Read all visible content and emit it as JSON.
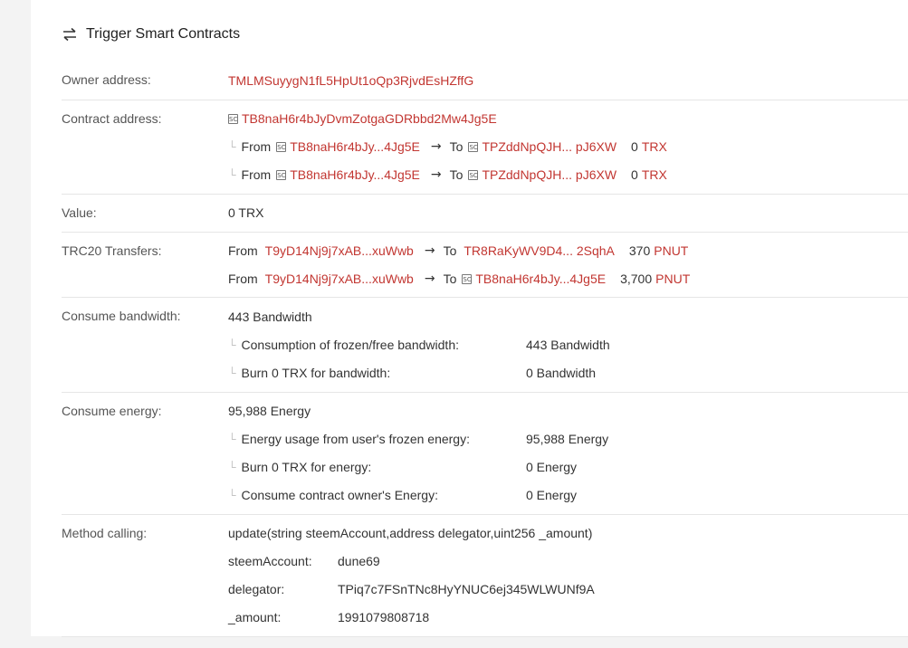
{
  "title": "Trigger Smart Contracts",
  "owner": {
    "label": "Owner address:",
    "address": "TMLMSuyygN1fL5HpUt1oQp3RjvdEsHZffG"
  },
  "contract": {
    "label": "Contract address:",
    "address": "TB8naH6r4bJyDvmZotgaGDRbbd2Mw4Jg5E",
    "internal": [
      {
        "from_word": "From",
        "from": "TB8naH6r4bJy...4Jg5E",
        "to_word": "To",
        "to": "TPZddNpQJH... pJ6XW",
        "amount": "0",
        "unit": "TRX"
      },
      {
        "from_word": "From",
        "from": "TB8naH6r4bJy...4Jg5E",
        "to_word": "To",
        "to": "TPZddNpQJH... pJ6XW",
        "amount": "0",
        "unit": "TRX"
      }
    ]
  },
  "value": {
    "label": "Value:",
    "text": "0 TRX"
  },
  "trc20": {
    "label": "TRC20 Transfers:",
    "transfers": [
      {
        "from_word": "From",
        "from": "T9yD14Nj9j7xAB...xuWwb",
        "to_word": "To",
        "to": "TR8RaKyWV9D4... 2SqhA",
        "amount": "370",
        "token": "PNUT"
      },
      {
        "from_word": "From",
        "from": "T9yD14Nj9j7xAB...xuWwb",
        "to_word": "To",
        "to": "TB8naH6r4bJy...4Jg5E",
        "amount": "3,700",
        "token": "PNUT"
      }
    ]
  },
  "bandwidth": {
    "label": "Consume bandwidth:",
    "total": "443 Bandwidth",
    "items": [
      {
        "name": "Consumption of frozen/free bandwidth:",
        "value": "443 Bandwidth"
      },
      {
        "name": "Burn 0 TRX for bandwidth:",
        "value": "0 Bandwidth"
      }
    ]
  },
  "energy": {
    "label": "Consume energy:",
    "total": "95,988 Energy",
    "items": [
      {
        "name": "Energy usage from user's frozen energy:",
        "value": "95,988 Energy"
      },
      {
        "name": "Burn 0 TRX for energy:",
        "value": "0 Energy"
      },
      {
        "name": "Consume contract owner's Energy:",
        "value": "0 Energy"
      }
    ]
  },
  "method": {
    "label": "Method calling:",
    "signature": "update(string steemAccount,address delegator,uint256 _amount)",
    "params": [
      {
        "name": "steemAccount:",
        "value": "dune69"
      },
      {
        "name": "delegator:",
        "value": "TPiq7c7FSnTNc8HyYNUC6ej345WLWUNf9A"
      },
      {
        "name": "_amount:",
        "value": "1991079808718"
      }
    ]
  },
  "colors": {
    "link": "#c23631",
    "border": "#e6e6e6"
  },
  "icons": {
    "title": "swap-arrows-icon",
    "contract": "contract-icon",
    "arrow": "right-arrow-icon",
    "indent": "indent-corner-icon"
  }
}
